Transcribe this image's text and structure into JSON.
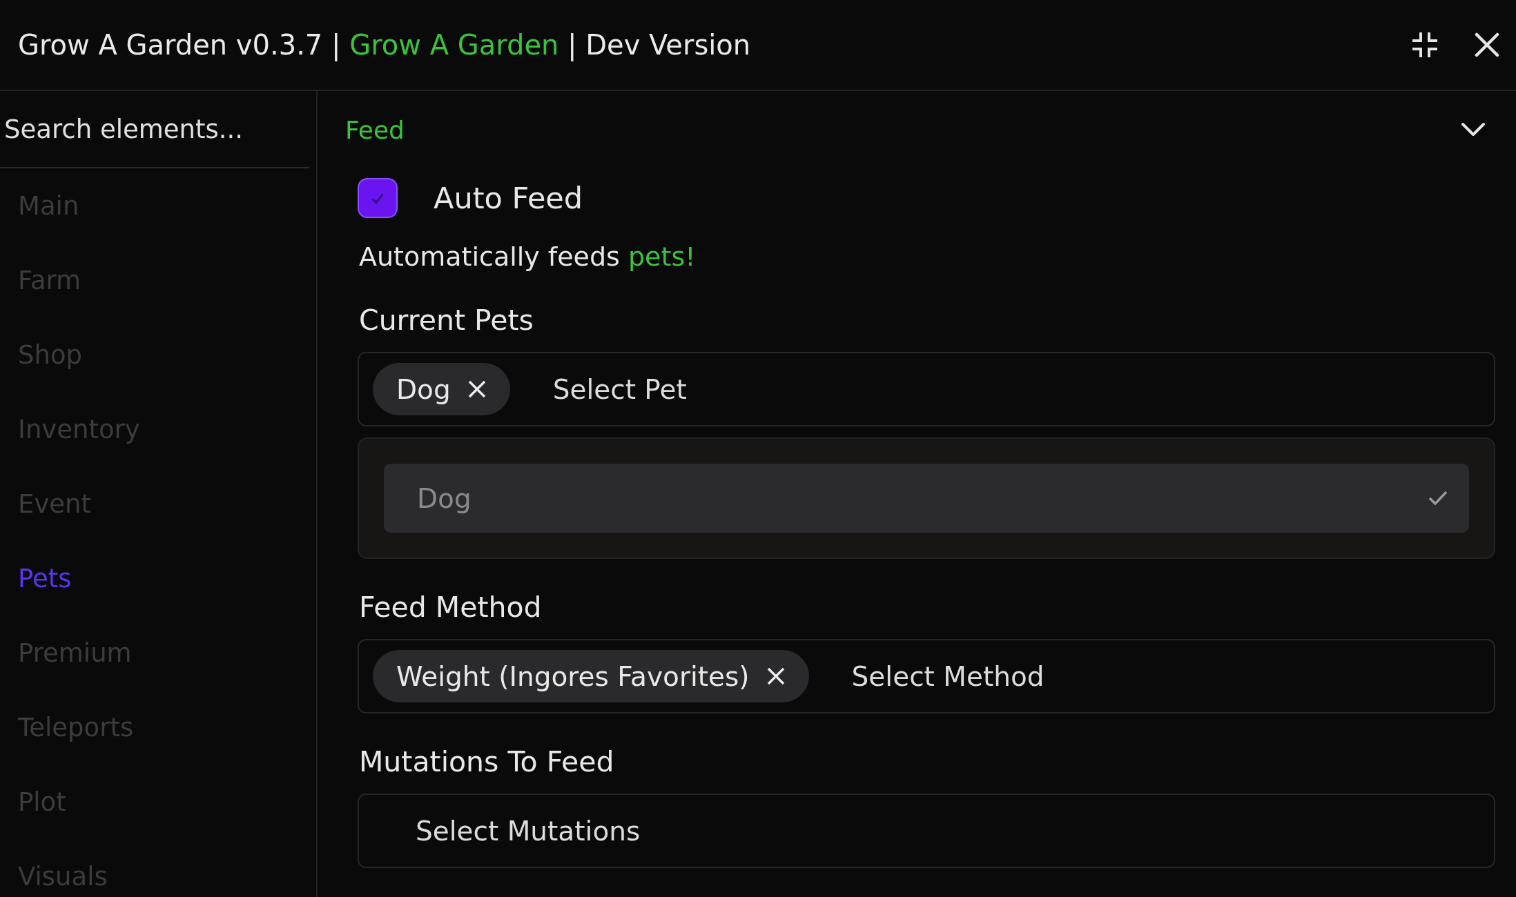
{
  "window": {
    "title_parts": [
      {
        "text": "Grow A Garden v0.3.7 |",
        "accent": false
      },
      {
        "text": "Grow A Garden",
        "accent": true
      },
      {
        "text": "| Dev Version",
        "accent": false
      }
    ]
  },
  "sidebar": {
    "search": {
      "placeholder": "Search elements..."
    },
    "items": [
      {
        "label": "Main",
        "selected": false
      },
      {
        "label": "Farm",
        "selected": false
      },
      {
        "label": "Shop",
        "selected": false
      },
      {
        "label": "Inventory",
        "selected": false
      },
      {
        "label": "Event",
        "selected": false
      },
      {
        "label": "Pets",
        "selected": true
      },
      {
        "label": "Premium",
        "selected": false
      },
      {
        "label": "Teleports",
        "selected": false
      },
      {
        "label": "Plot",
        "selected": false
      },
      {
        "label": "Visuals",
        "selected": false
      }
    ]
  },
  "section": {
    "title": "Feed",
    "expanded": true,
    "controls": [
      {
        "kind": "checkbox",
        "label": "Auto Feed",
        "checked": true
      },
      {
        "kind": "note",
        "parts": [
          {
            "text": "Automatically feeds",
            "accent": false
          },
          {
            "text": "pets!",
            "accent": true
          }
        ]
      },
      {
        "kind": "multiselect",
        "label": "Current Pets",
        "chips": [
          "Dog"
        ],
        "placeholder": "Select Pet",
        "options": [
          {
            "label": "Dog",
            "selected": true
          }
        ]
      },
      {
        "kind": "multiselect",
        "label": "Feed Method",
        "chips": [
          "Weight (Ingores Favorites)"
        ],
        "placeholder": "Select Method"
      },
      {
        "kind": "multiselect",
        "label": "Mutations To Feed",
        "placeholder": "Select Mutations"
      }
    ]
  }
}
